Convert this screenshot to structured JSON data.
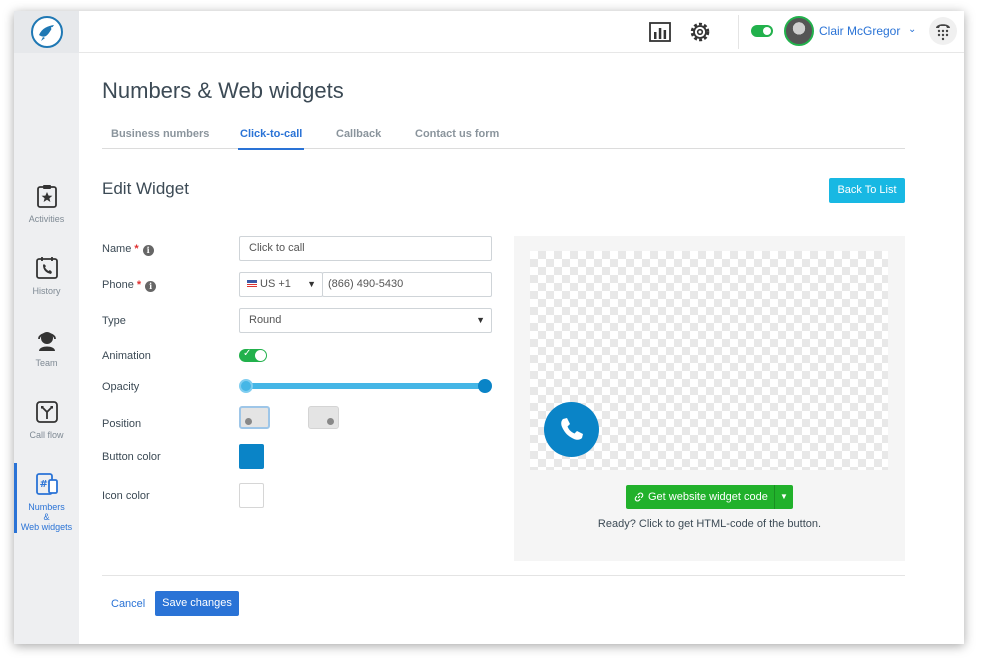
{
  "user": {
    "name": "Clair McGregor"
  },
  "sidebar": {
    "items": [
      {
        "label": "Activities",
        "icon": "star-clipboard-icon"
      },
      {
        "label": "History",
        "icon": "phone-calendar-icon"
      },
      {
        "label": "Team",
        "icon": "headset-agent-icon"
      },
      {
        "label": "Call flow",
        "icon": "call-flow-icon"
      },
      {
        "label_line1": "Numbers",
        "label_line2": "&",
        "label_line3": "Web widgets",
        "icon": "hash-phone-icon",
        "active": true
      }
    ]
  },
  "page": {
    "title": "Numbers & Web widgets"
  },
  "tabs": [
    {
      "label": "Business numbers"
    },
    {
      "label": "Click-to-call",
      "active": true
    },
    {
      "label": "Callback"
    },
    {
      "label": "Contact us form"
    }
  ],
  "form": {
    "title": "Edit Widget",
    "back_label": "Back To List",
    "name_label": "Name",
    "name_value": "Click to call",
    "phone_label": "Phone",
    "country_code": "US +1",
    "phone_value": "(866) 490-5430",
    "type_label": "Type",
    "type_value": "Round",
    "animation_label": "Animation",
    "animation_on": true,
    "opacity_label": "Opacity",
    "opacity_value": 1.0,
    "position_label": "Position",
    "button_color_label": "Button color",
    "button_color": "#0a84c7",
    "icon_color_label": "Icon color",
    "icon_color": "#ffffff",
    "required_mark": "*",
    "info_glyph": "i"
  },
  "preview": {
    "get_code_label": "Get website widget code",
    "ready_text": "Ready? Click to get HTML-code of the button."
  },
  "footer": {
    "cancel_label": "Cancel",
    "save_label": "Save changes"
  },
  "colors": {
    "accent": "#2a73d6",
    "green": "#21b12b",
    "cyan": "#18b8e3"
  }
}
